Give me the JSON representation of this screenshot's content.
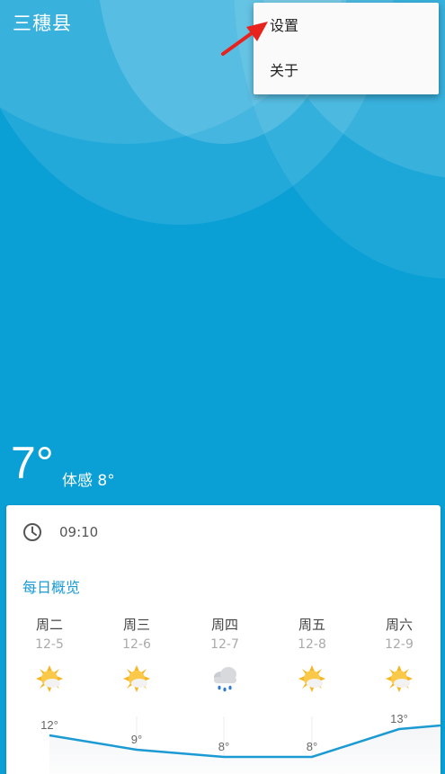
{
  "header": {
    "city": "三穗县"
  },
  "menu": {
    "items": [
      {
        "label": "设置"
      },
      {
        "label": "关于"
      }
    ]
  },
  "current": {
    "temperature": "7°",
    "feels_like": "体感 8°"
  },
  "card": {
    "update_time": "09:10",
    "section_title": "每日概览",
    "days": [
      {
        "name": "周二",
        "date": "12-5",
        "icon": "sunny-cloud-icon",
        "high": "12°"
      },
      {
        "name": "周三",
        "date": "12-6",
        "icon": "sunny-cloud-icon",
        "high": "9°"
      },
      {
        "name": "周四",
        "date": "12-7",
        "icon": "rain-icon",
        "high": "8°"
      },
      {
        "name": "周五",
        "date": "12-8",
        "icon": "sunny-cloud-icon",
        "high": "8°"
      },
      {
        "name": "周六",
        "date": "12-9",
        "icon": "sunny-cloud-icon",
        "high": "13°"
      }
    ]
  },
  "colors": {
    "sky": "#0aa0d6",
    "accent": "#1b9ad3",
    "line": "#1b9ad3"
  }
}
